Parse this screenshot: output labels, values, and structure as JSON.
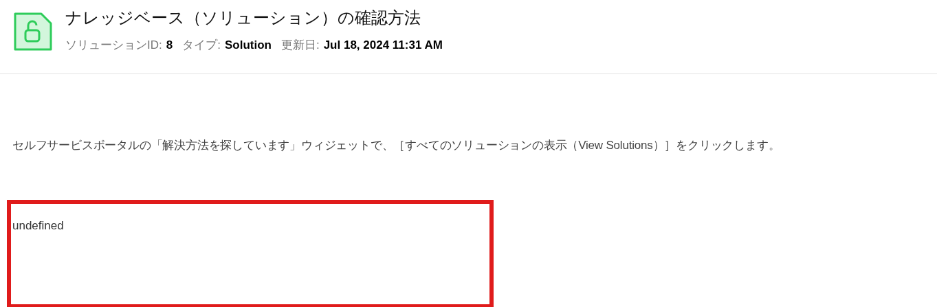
{
  "header": {
    "title": "ナレッジベース（ソリューション）の確認方法",
    "meta": [
      {
        "label": "ソリューションID:",
        "value": "8"
      },
      {
        "label": "タイプ:",
        "value": "Solution"
      },
      {
        "label": "更新日:",
        "value": "Jul 18, 2024 11:31 AM"
      }
    ]
  },
  "body": {
    "paragraph": "セルフサービスポータルの「解決方法を探しています」ウィジェットで、［すべてのソリューションの表示（View Solutions）］をクリックします。",
    "highlight_box": {
      "text": "undefined"
    }
  }
}
